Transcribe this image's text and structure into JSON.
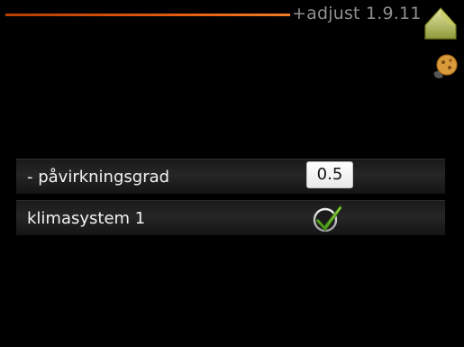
{
  "header": {
    "title": "+adjust 1.9.11",
    "accent_color": "#e25c10"
  },
  "icons": {
    "home": "home-icon",
    "smart_grid": "smart-price-icon"
  },
  "settings": {
    "rows": [
      {
        "label": "- påvirkningsgrad",
        "value": "0.5",
        "control": "numeric-value-box"
      },
      {
        "label": "klimasystem 1",
        "checked": true,
        "control": "checkbox"
      }
    ]
  }
}
